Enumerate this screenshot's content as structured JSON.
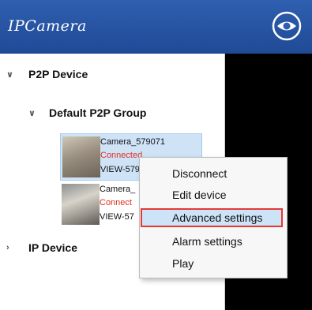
{
  "header": {
    "brand": "IPCamera",
    "eye_icon": "eye-icon",
    "colors": {
      "bar": "#2f5fb0"
    }
  },
  "tree": {
    "p2p_root": {
      "label": "P2P Device",
      "icon": "chevron-down-icon"
    },
    "p2p_group": {
      "label": "Default P2P Group",
      "icon": "chevron-down-icon"
    },
    "cameras": [
      {
        "name": "Camera_579071",
        "status": "Connected",
        "id": "VIEW-579",
        "selected": true
      },
      {
        "name": "Camera_",
        "status": "Connect",
        "id": "VIEW-57",
        "selected": false
      }
    ],
    "ip_root": {
      "label": "IP Device",
      "icon": "chevron-right-icon"
    }
  },
  "context_menu": {
    "items": [
      {
        "label": "Disconnect"
      },
      {
        "label": "Edit device"
      },
      {
        "label": "Advanced settings",
        "highlighted": true
      },
      {
        "label": "Alarm settings"
      },
      {
        "label": "Play"
      }
    ],
    "highlight_color": "#e53935"
  }
}
